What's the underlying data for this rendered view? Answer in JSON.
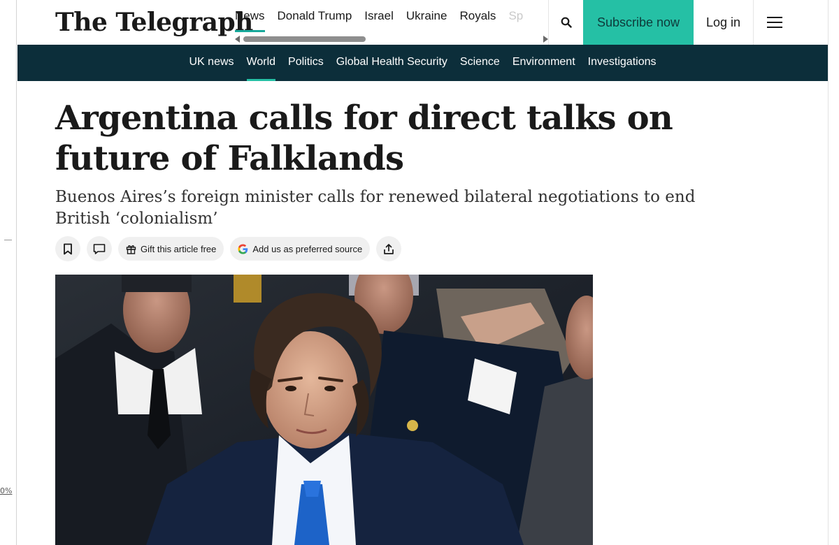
{
  "gutter": {
    "zoom_label": "0%"
  },
  "masthead": {
    "logo": "The Telegraph",
    "topnav": [
      "News",
      "Donald Trump",
      "Israel",
      "Ukraine",
      "Royals",
      "Sp"
    ],
    "subscribe_label": "Subscribe now",
    "login_label": "Log in"
  },
  "sectionnav": [
    "UK news",
    "World",
    "Politics",
    "Global Health Security",
    "Science",
    "Environment",
    "Investigations"
  ],
  "article": {
    "headline": "Argentina calls for direct talks on future of Falklands",
    "standfirst": "Buenos Aires’s foreign minister calls for renewed bilateral negotiations to end British ‘colonialism’",
    "actions": {
      "gift_label": "Gift this article free",
      "preferred_label": "Add us as preferred source"
    }
  },
  "colors": {
    "accent": "#25c0a5",
    "section_bar": "#0c2e3a",
    "text": "#1a1a1a"
  },
  "icons": [
    "search-icon",
    "hamburger-icon",
    "bookmark-icon",
    "comment-icon",
    "gift-icon",
    "google-icon",
    "share-icon"
  ]
}
